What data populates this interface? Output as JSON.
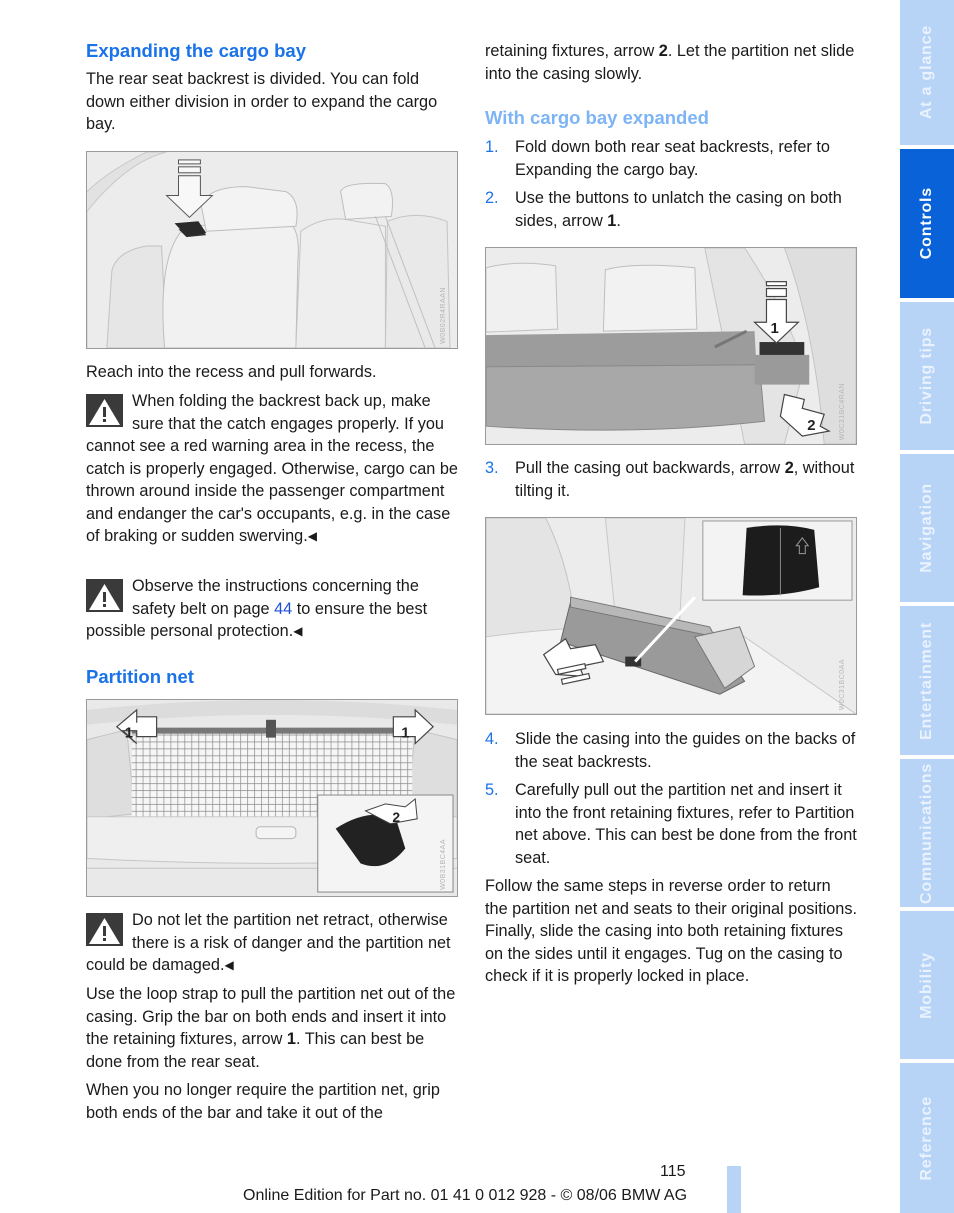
{
  "left": {
    "heading_expanding": "Expanding the cargo bay",
    "intro": "The rear seat backrest is divided. You can fold down either division in order to expand the cargo bay.",
    "figure1_code": "W0B02R4RAAN",
    "reach": "Reach into the recess and pull forwards.",
    "warning1": "When folding the backrest back up, make sure that the catch engages properly. If you cannot see a red warning area in the recess, the catch is properly engaged. Otherwise, cargo can be thrown around inside the passenger compartment and endanger the car's occupants, e.g. in the case of braking or sudden swerving.",
    "warning2_before": "Observe the instructions concerning the safety belt on page ",
    "warning2_link": "44",
    "warning2_after": " to ensure the best possible personal protection.",
    "heading_partition": "Partition net",
    "figure2_code": "W0B31BC4AA",
    "figure2_labels": [
      "1",
      "1",
      "2"
    ],
    "warning3": "Do not let the partition net retract, otherwise there is a risk of danger and the partition net could be damaged.",
    "loop_before": "Use the loop strap to pull the partition net out of the casing. Grip the bar on both ends and insert it into the retaining fixtures, arrow ",
    "loop_bold": "1",
    "loop_after": ". This can best be done from the rear seat.",
    "no_longer": "When you no longer require the partition net, grip both ends of the bar and take it out of the"
  },
  "right": {
    "cont_before": "retaining fixtures, arrow ",
    "cont_bold": "2",
    "cont_after": ". Let the partition net slide into the casing slowly.",
    "heading_expanded": "With cargo bay expanded",
    "steps": [
      {
        "num": "1.",
        "text": "Fold down both rear seat backrests, refer to Expanding the cargo bay."
      },
      {
        "num": "2.",
        "text_before": "Use the buttons to unlatch the casing on both sides, arrow ",
        "bold": "1",
        "text_after": "."
      },
      {
        "num": "3.",
        "text_before": "Pull the casing out backwards, arrow ",
        "bold": "2",
        "text_after": ", without tilting it."
      },
      {
        "num": "4.",
        "text": "Slide the casing into the guides on the backs of the seat backrests."
      },
      {
        "num": "5.",
        "text": "Carefully pull out the partition net and insert it into the front retaining fixtures, refer to Partition net above. This can best be done from the front seat."
      }
    ],
    "figure3_code": "W0C31BC4RAN",
    "figure3_labels": [
      "1",
      "2"
    ],
    "figure4_code": "W0C31BC0AA",
    "follow": "Follow the same steps in reverse order to return the partition net and seats to their original positions. Finally, slide the casing into both retaining fixtures on the sides until it engages. Tug on the casing to check if it is properly locked in place."
  },
  "end_mark": "◀",
  "sidebar": {
    "tabs": [
      {
        "label": "At a glance",
        "active": false
      },
      {
        "label": "Controls",
        "active": true
      },
      {
        "label": "Driving tips",
        "active": false
      },
      {
        "label": "Navigation",
        "active": false
      },
      {
        "label": "Entertainment",
        "active": false
      },
      {
        "label": "Communications",
        "active": false
      },
      {
        "label": "Mobility",
        "active": false
      },
      {
        "label": "Reference",
        "active": false
      }
    ],
    "colors": {
      "active": "#0962d8",
      "inactive": "#b7d4f7"
    }
  },
  "footer": {
    "page_number": "115",
    "edition": "Online Edition for Part no. 01 41 0 012 928 - © 08/06 BMW AG"
  }
}
